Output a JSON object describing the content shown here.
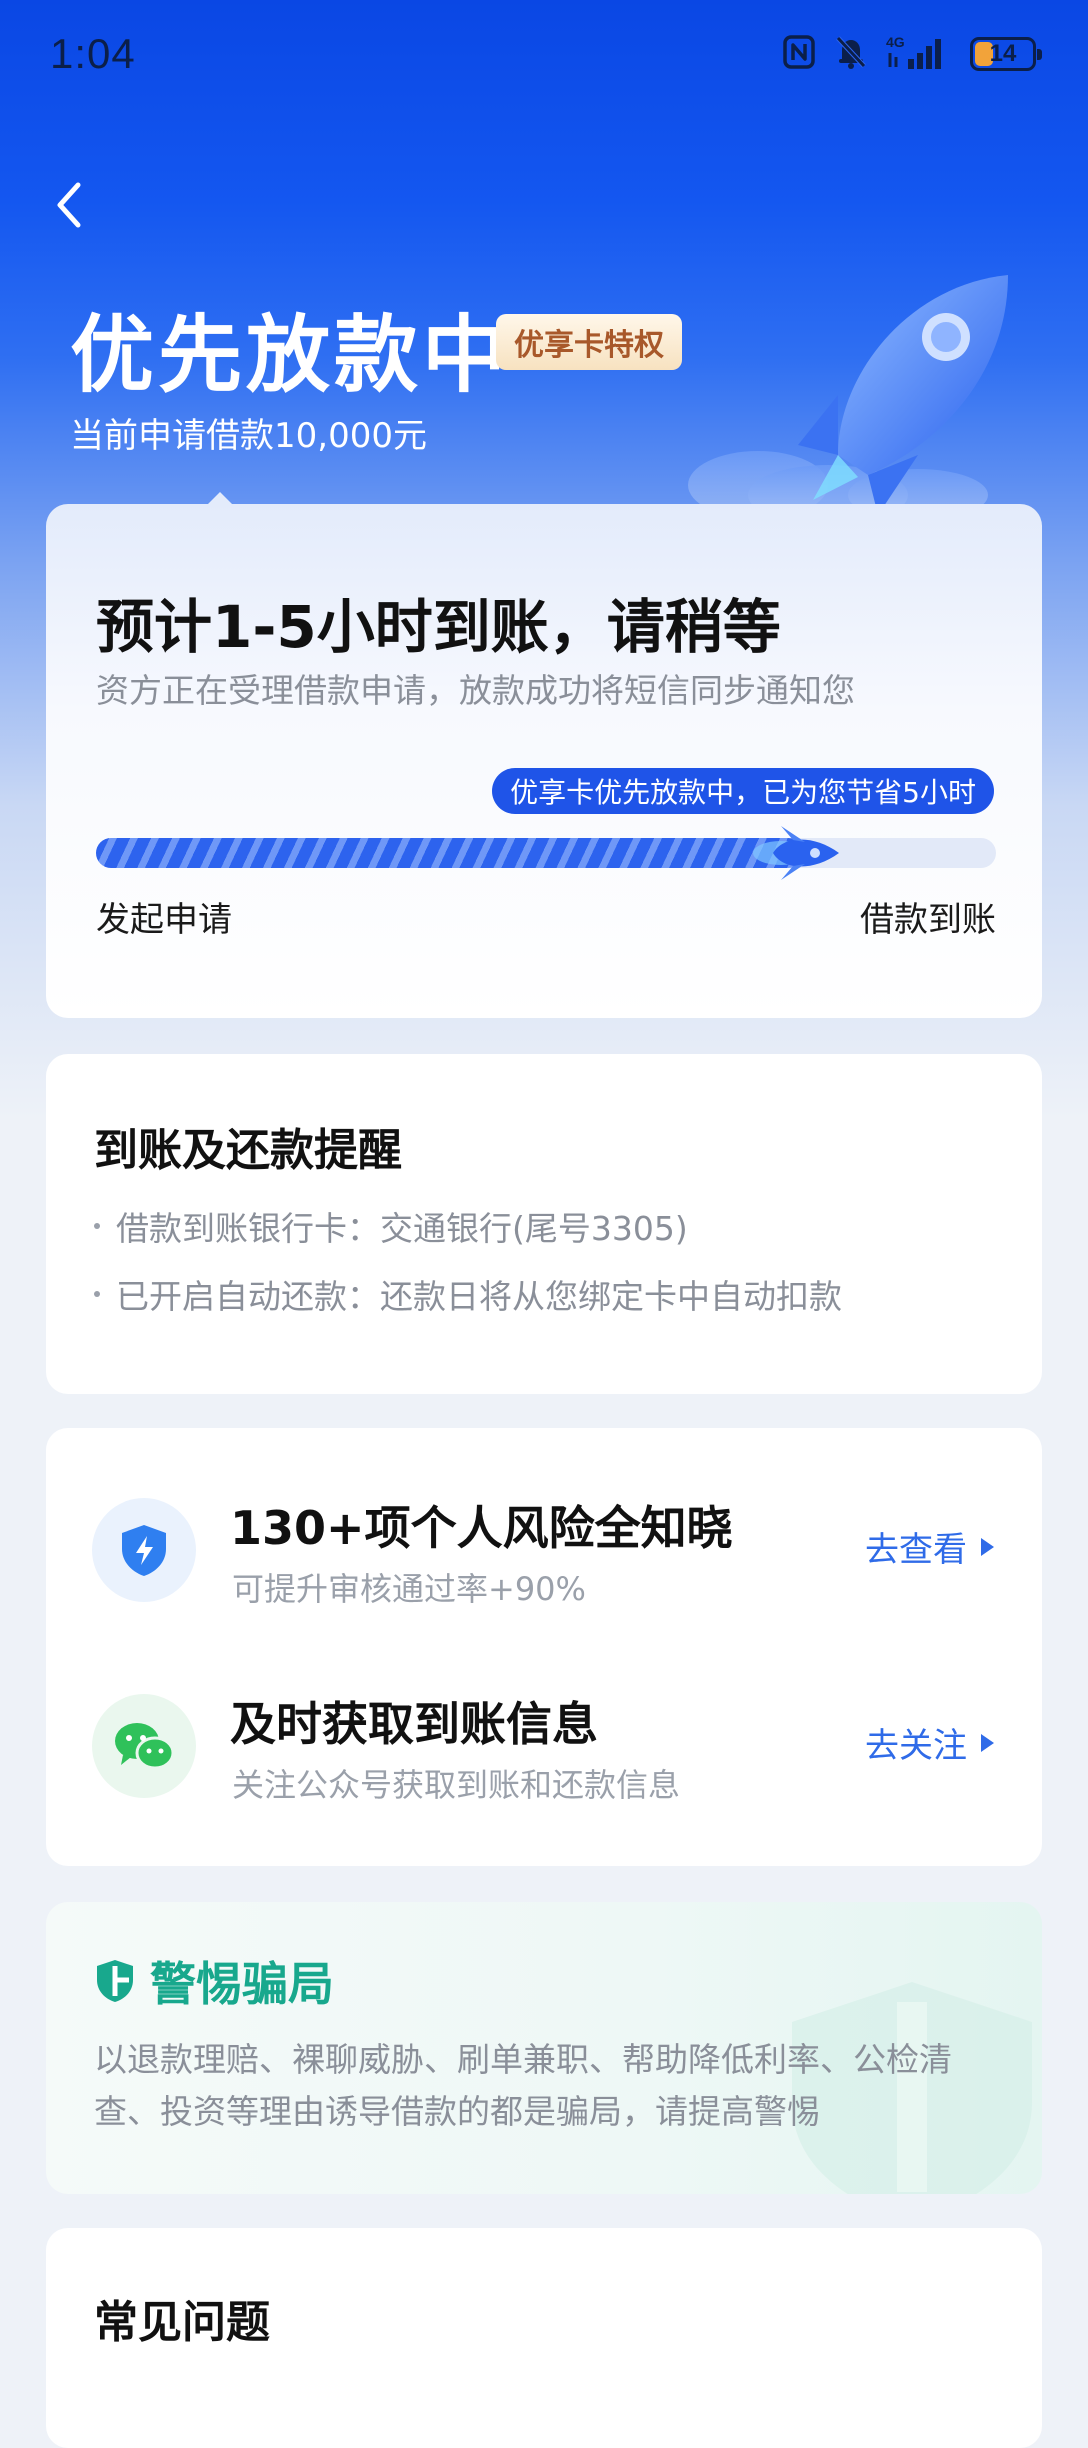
{
  "status_bar": {
    "time": "1:04",
    "network": "4G",
    "battery": "14",
    "icons": [
      "nfc-icon",
      "mute-bell-icon",
      "signal-icon",
      "battery-icon"
    ]
  },
  "header": {
    "title": "优先放款中",
    "badge": "优享卡特权",
    "subtitle": "当前申请借款10,000元"
  },
  "status_card": {
    "eta_title": "预计1-5小时到账，请稍等",
    "description": "资方正在受理借款申请，放款成功将短信同步通知您",
    "tip": "优享卡优先放款中，已为您节省5小时",
    "progress": 0.83,
    "start_label": "发起申请",
    "end_label": "借款到账"
  },
  "reminder": {
    "title": "到账及还款提醒",
    "items": [
      "借款到账银行卡：交通银行(尾号3305)",
      "已开启自动还款：还款日将从您绑定卡中自动扣款"
    ]
  },
  "services": [
    {
      "icon": "shield-lightning-icon",
      "title": "130+项个人风险全知晓",
      "subtitle": "可提升审核通过率+90%",
      "action": "去查看"
    },
    {
      "icon": "wechat-icon",
      "title": "及时获取到账信息",
      "subtitle": "关注公众号获取到账和还款信息",
      "action": "去关注"
    }
  ],
  "warning": {
    "title": "警惕骗局",
    "text": "以退款理赔、裸聊威胁、刷单兼职、帮助降低利率、公检清查、投资等理由诱导借款的都是骗局，请提高警惕"
  },
  "faq": {
    "title": "常见问题"
  },
  "colors": {
    "primary_blue": "#1f54e8",
    "accent_green": "#18a88d",
    "badge_brown": "#a8582a"
  }
}
